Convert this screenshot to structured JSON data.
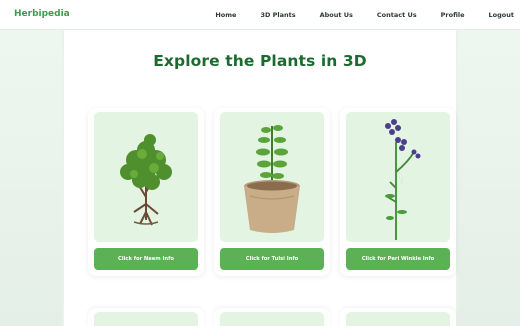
{
  "navbar": {
    "logo": "Herbipedia",
    "links": [
      "Home",
      "3D Plants",
      "About Us",
      "Contact Us",
      "Profile",
      "Logout"
    ]
  },
  "main": {
    "title": "Explore the Plants in 3D",
    "cards": [
      {
        "plant": "neem-tree",
        "button": "Click for Neem Info"
      },
      {
        "plant": "tulsi-pot",
        "button": "Click for Tulsi Info"
      },
      {
        "plant": "periwinkle",
        "button": "Click for Peri Winkle Info"
      }
    ]
  },
  "colors": {
    "brand": "#3e9c4e",
    "title": "#1d6a30",
    "button": "#5cb157",
    "card_bg": "#e3f4e2"
  }
}
